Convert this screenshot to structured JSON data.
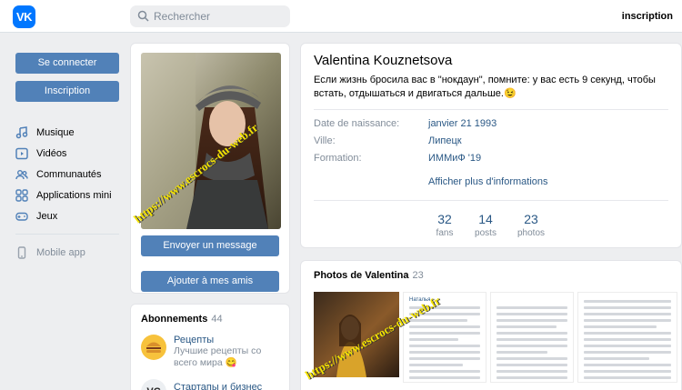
{
  "header": {
    "logo_text": "VK",
    "search_placeholder": "Rechercher",
    "signup_link": "inscription"
  },
  "sidebar": {
    "login_label": "Se connecter",
    "register_label": "Inscription",
    "items": [
      {
        "label": "Musique",
        "icon": "music-icon"
      },
      {
        "label": "Vidéos",
        "icon": "video-icon"
      },
      {
        "label": "Communautés",
        "icon": "communities-icon"
      },
      {
        "label": "Applications mini",
        "icon": "apps-icon"
      },
      {
        "label": "Jeux",
        "icon": "gamepad-icon"
      }
    ],
    "mobile_app": "Mobile app"
  },
  "profile": {
    "name": "Valentina Kouznetsova",
    "status": "Если жизнь бросила вас в \"нокдаун\", помните: у вас есть 9 секунд, чтобы встать, отдышаться и двигаться дальше.😉",
    "watermark": "https://www.escrocs-du-web.fr",
    "send_message": "Envoyer un message",
    "add_friend": "Ajouter à mes amis",
    "details": [
      {
        "label": "Date de naissance:",
        "value": "janvier 21 1993"
      },
      {
        "label": "Ville:",
        "value": "Липецк"
      },
      {
        "label": "Formation:",
        "value": "ИММиФ '19"
      }
    ],
    "show_more": "Afficher plus d'informations",
    "stats": [
      {
        "num": "32",
        "label": "fans"
      },
      {
        "num": "14",
        "label": "posts"
      },
      {
        "num": "23",
        "label": "photos"
      }
    ]
  },
  "subscriptions": {
    "title": "Abonnements",
    "count": "44",
    "items": [
      {
        "name": "Рецепты",
        "desc": "Лучшие рецепты со всего мира 😋"
      },
      {
        "name": "Стартапы и бизнес",
        "avatar": "VC"
      }
    ]
  },
  "photos": {
    "title": "Photos de Valentina",
    "count": "23",
    "chat_name": "Наталья"
  },
  "colors": {
    "accent": "#5181b8",
    "link": "#2a5885",
    "muted": "#818c99",
    "watermark": "#f4e300"
  }
}
